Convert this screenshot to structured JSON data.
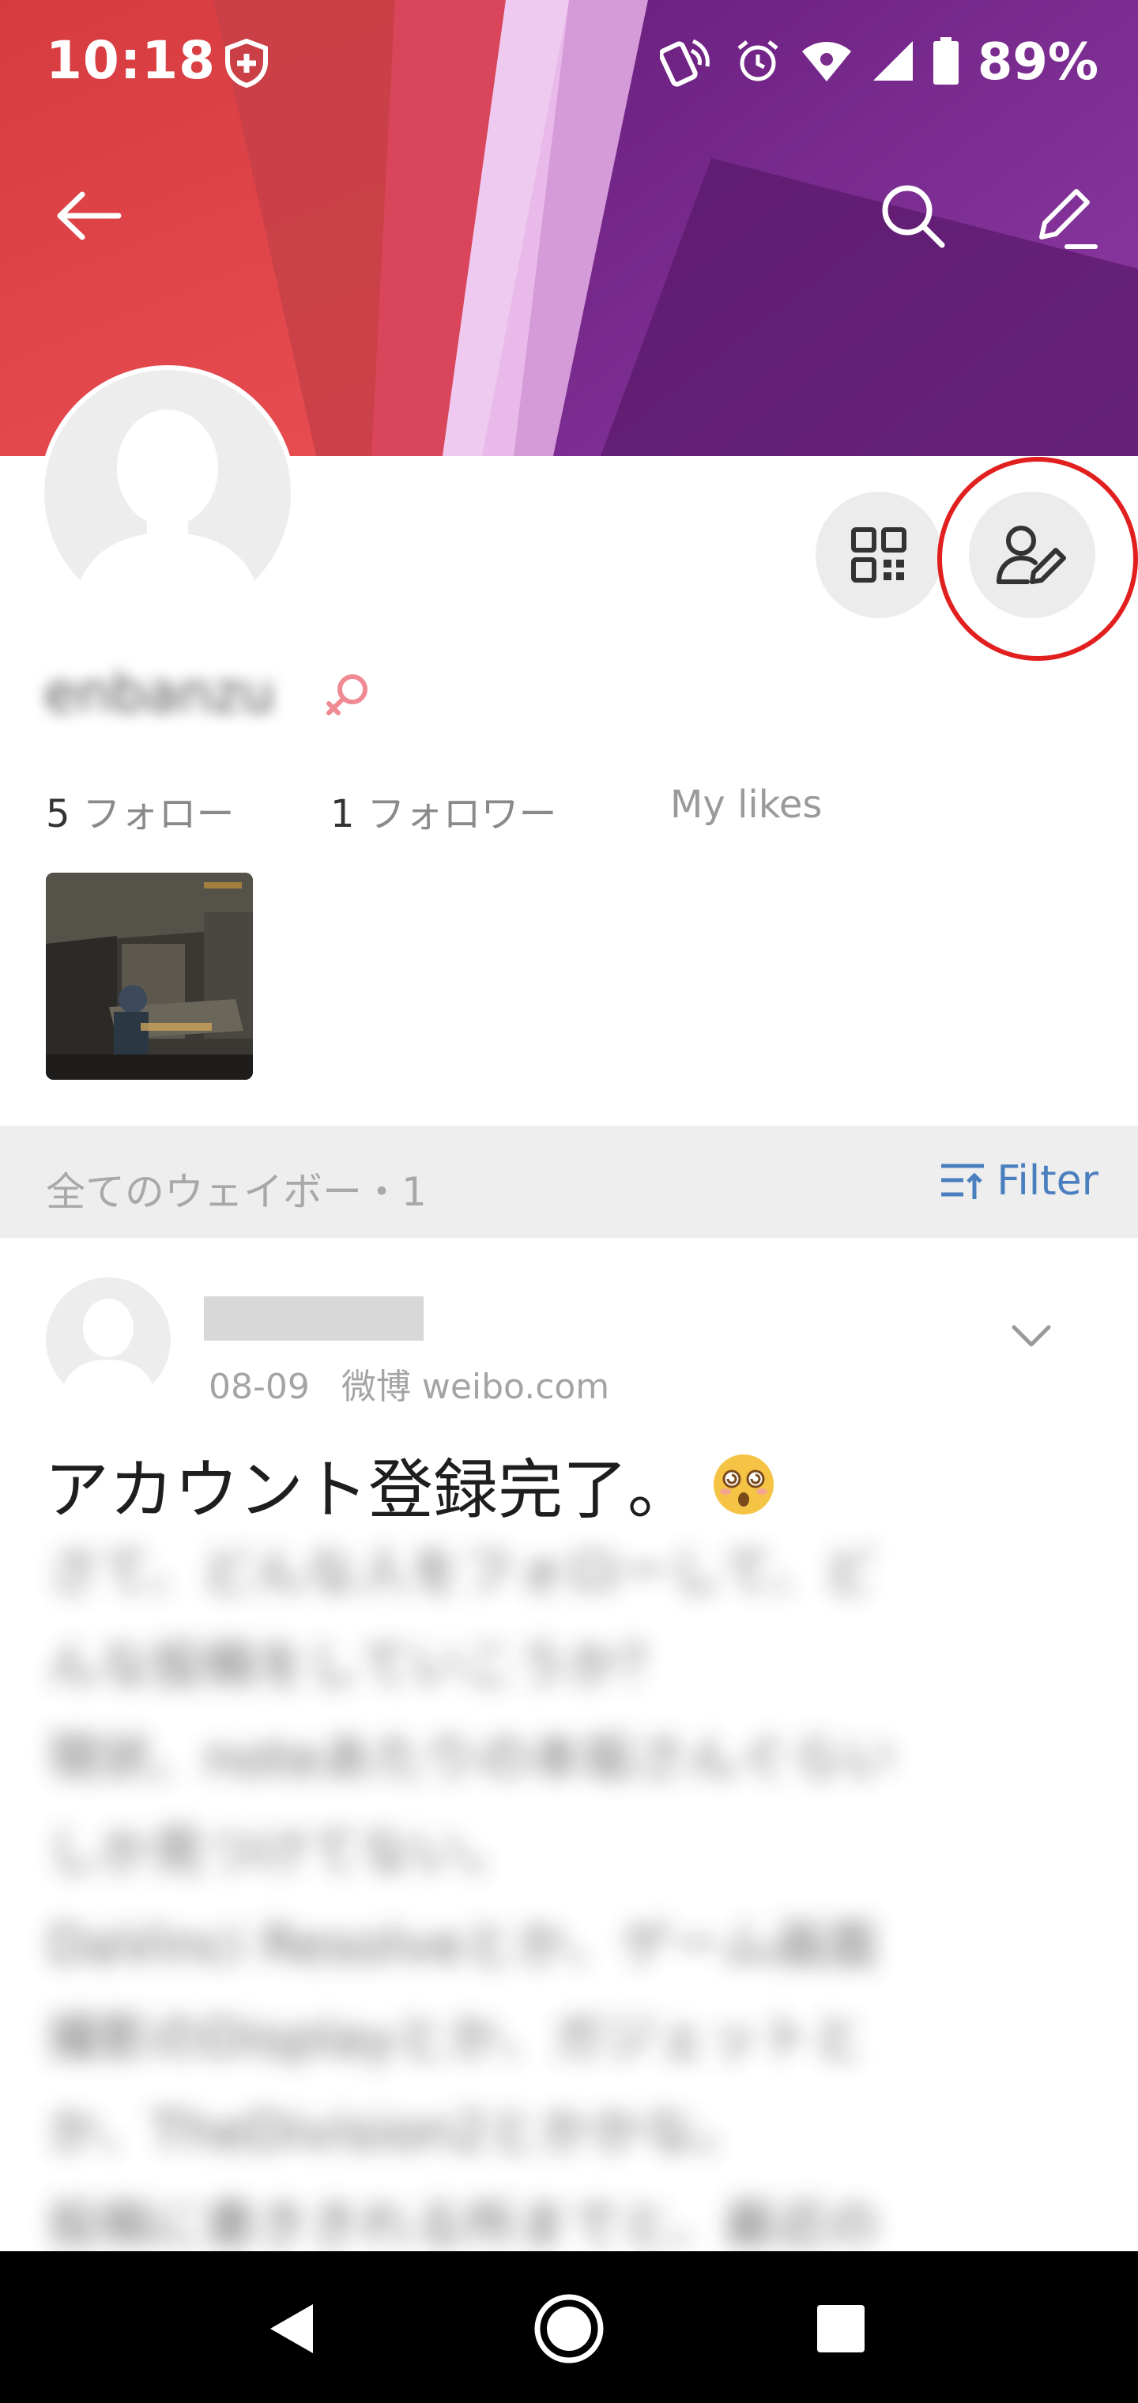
{
  "status_bar": {
    "time": "10:18",
    "battery_percent": "89%",
    "icons": [
      "shield-plus-icon",
      "nfc-icon",
      "alarm-icon",
      "wifi-icon",
      "signal-icon",
      "battery-icon"
    ]
  },
  "toolbar": {
    "back_icon": "arrow-left-icon",
    "search_icon": "search-icon",
    "edit_icon": "pencil-icon"
  },
  "profile": {
    "username": "enbanzu",
    "gender_icon": "female-icon",
    "qr_icon": "qr-code-icon",
    "edit_profile_icon": "user-edit-icon",
    "stats": [
      {
        "count": "5",
        "label": "フォロー"
      },
      {
        "count": "1",
        "label": "フォロワー"
      },
      {
        "count": "",
        "label": "My likes"
      }
    ]
  },
  "filter_bar": {
    "title": "全てのウェイボー・1",
    "filter_label": "Filter"
  },
  "post": {
    "date": "08-09",
    "source": "微博 weibo.com",
    "title": "アカウント登録完了。",
    "emoji_icon": "dizzy-face-emoji",
    "body_lines": [
      "さて、どんな人をフォローして、ど",
      "んな投稿をしていこうか？",
      "現状、noteあたりの本垢さんぐらい",
      "しか見つけてない。",
      "DaVinci Resolveとか、ゲーム画面",
      "撮影のDisplayとか、ガジェットと",
      "か、TheDivision2とかかな。",
      "投稿に書ききれる所までと、最近の"
    ]
  },
  "nav_bar": {
    "back_icon": "triangle-back-icon",
    "home_icon": "circle-home-icon",
    "recents_icon": "square-recents-icon"
  },
  "colors": {
    "accent_link": "#4a7fbf",
    "highlight_ring": "#e21f1f",
    "banner_left": "#e8474a",
    "banner_right": "#7b2a8e"
  }
}
